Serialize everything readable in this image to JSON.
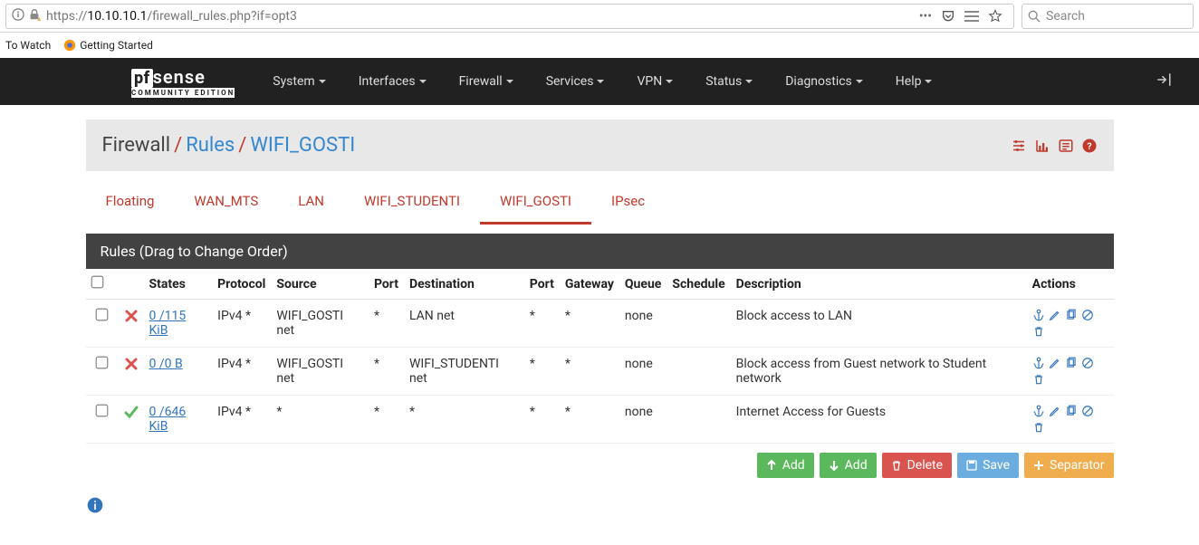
{
  "browser": {
    "url_prefix": "https://",
    "url_host": "10.10.10.1",
    "url_path": "/firewall_rules.php?if=opt3",
    "search_placeholder": "Search",
    "bookmarks": {
      "b1": "To Watch",
      "b2": "Getting Started"
    }
  },
  "logo": {
    "top": "pfsense",
    "bottom": "COMMUNITY EDITION"
  },
  "nav": {
    "system": "System",
    "interfaces": "Interfaces",
    "firewall": "Firewall",
    "services": "Services",
    "vpn": "VPN",
    "status": "Status",
    "diagnostics": "Diagnostics",
    "help": "Help"
  },
  "breadcrumb": {
    "root": "Firewall",
    "sep": "/",
    "a": "Rules",
    "b": "WIFI_GOSTI"
  },
  "tabs": {
    "floating": "Floating",
    "wan": "WAN_MTS",
    "lan": "LAN",
    "wifi_stu": "WIFI_STUDENTI",
    "wifi_gosti": "WIFI_GOSTI",
    "ipsec": "IPsec"
  },
  "panel_title": "Rules (Drag to Change Order)",
  "headers": {
    "states": "States",
    "protocol": "Protocol",
    "source": "Source",
    "port_s": "Port",
    "dest": "Destination",
    "port_d": "Port",
    "gateway": "Gateway",
    "queue": "Queue",
    "schedule": "Schedule",
    "description": "Description",
    "actions": "Actions"
  },
  "rows": [
    {
      "status": "block",
      "states": "0 /115 KiB",
      "proto": "IPv4 *",
      "src": "WIFI_GOSTI net",
      "sport": "*",
      "dst": "LAN net",
      "dport": "*",
      "gw": "*",
      "queue": "none",
      "sched": "",
      "desc": "Block access to LAN"
    },
    {
      "status": "block",
      "states": "0 /0 B",
      "proto": "IPv4 *",
      "src": "WIFI_GOSTI net",
      "sport": "*",
      "dst": "WIFI_STUDENTI net",
      "dport": "*",
      "gw": "*",
      "queue": "none",
      "sched": "",
      "desc": "Block access from Guest network to Student network"
    },
    {
      "status": "pass",
      "states": "0 /646 KiB",
      "proto": "IPv4 *",
      "src": "*",
      "sport": "*",
      "dst": "*",
      "dport": "*",
      "gw": "*",
      "queue": "none",
      "sched": "",
      "desc": "Internet Access for Guests"
    }
  ],
  "buttons": {
    "add_top": "Add",
    "add_bottom": "Add",
    "delete": "Delete",
    "save": "Save",
    "separator": "Separator"
  }
}
